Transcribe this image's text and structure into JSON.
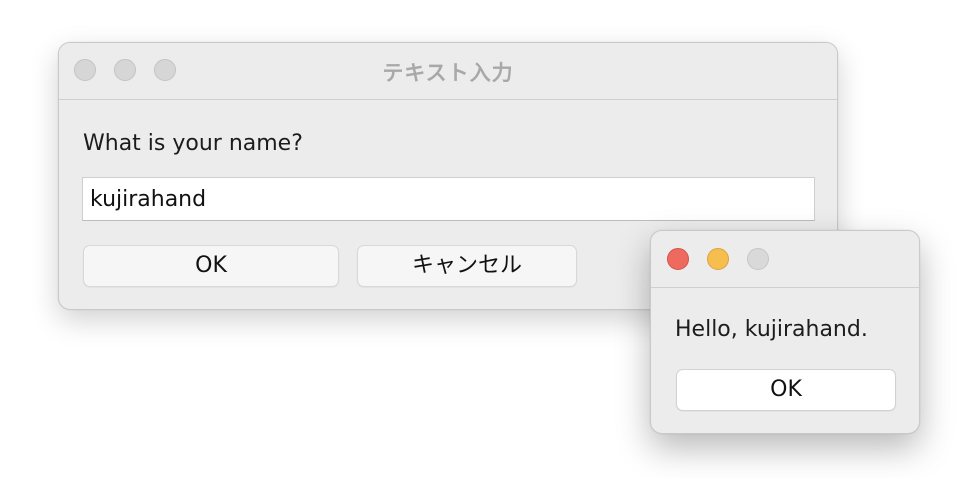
{
  "main_window": {
    "title": "テキスト入力",
    "prompt": "What is your name?",
    "input_value": "kujirahand",
    "ok_label": "OK",
    "cancel_label": "キャンセル",
    "traffic_lights": [
      "inactive",
      "inactive",
      "inactive"
    ]
  },
  "alert_window": {
    "message": "Hello, kujirahand.",
    "ok_label": "OK",
    "traffic_lights": [
      "close-red",
      "minimize-yellow",
      "zoom-gray"
    ]
  },
  "colors": {
    "close_red": "#ee6a5f",
    "minimize_yellow": "#f5be4f",
    "inactive_gray": "#d6d6d6",
    "window_bg": "#ececec"
  }
}
